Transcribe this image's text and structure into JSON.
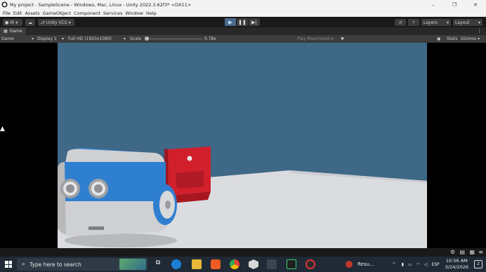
{
  "window": {
    "title": "My project - SampleScene - Windows, Mac, Linux - Unity 2022.3.62f3* <DX11>",
    "controls": [
      "–",
      "❐",
      "✕"
    ]
  },
  "menubar": [
    "File",
    "Edit",
    "Assets",
    "GameObject",
    "Component",
    "Services",
    "Window",
    "Help"
  ],
  "toolbar": {
    "account": "IR",
    "vcs": "Unity VCS",
    "layers": "Layers",
    "layout": "Layout"
  },
  "game_tab": {
    "label": "Game"
  },
  "game_toolbar": {
    "view": "Game",
    "display": "Display 1",
    "resolution": "Full HD (1920x1080)",
    "scale_label": "Scale",
    "scale_value": "0.78x",
    "play_mode": "Play Maximized",
    "stats": "Stats",
    "gizmos": "Gizmos"
  },
  "taskbar": {
    "search_placeholder": "Type here to search",
    "resume_app": "Resu...",
    "language": "ESP",
    "time": "10:56 AM",
    "date": "3/24/2026",
    "notifications": "2"
  },
  "colors": {
    "sky": "#3f6887",
    "ground": "#dadce0",
    "robot_blue": "#2f7fd0",
    "robot_white": "#d8d9da",
    "red_box": "#d11f2b"
  },
  "icons": [
    "unity-logo-icon",
    "account-icon",
    "cloud-icon",
    "vcs-icon",
    "play-icon",
    "pause-icon",
    "step-icon",
    "history-icon",
    "search-icon",
    "kebab-menu-icon",
    "mute-icon",
    "windows-start-icon",
    "search-icon",
    "task-view-icon",
    "edge-icon",
    "file-explorer-icon",
    "brave-icon",
    "chrome-icon",
    "unity-hub-icon",
    "unity-icon",
    "terminal-icon",
    "recorder-icon",
    "wifi-icon",
    "volume-icon",
    "battery-icon",
    "notification-icon"
  ]
}
